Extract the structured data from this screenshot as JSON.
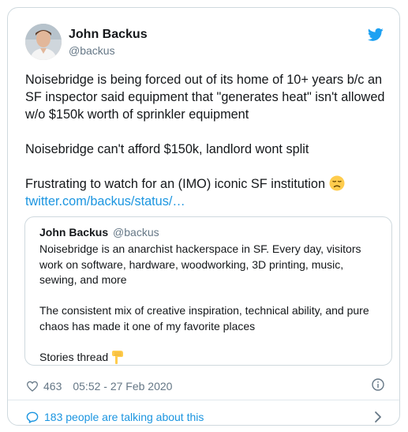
{
  "author": {
    "name": "John Backus",
    "handle": "@backus"
  },
  "tweet": {
    "paragraphs": [
      "Noisebridge is being forced out of its home of 10+ years b/c an SF inspector said equipment that \"generates heat\" isn't allowed w/o $150k worth of sprinkler equipment",
      "Noisebridge can't afford $150k, landlord wont split",
      "Frustrating to watch for an (IMO) iconic SF institution"
    ],
    "emoji": "disappointed-face-emoji",
    "link": "twitter.com/backus/status/…"
  },
  "quoted": {
    "name": "John Backus",
    "handle": "@backus",
    "paragraphs": [
      "Noisebridge is an anarchist hackerspace in SF. Every day, visitors work on software, hardware, woodworking, 3D printing, music, sewing, and more",
      "The consistent mix of creative inspiration, technical ability, and pure chaos has made it one of my favorite places",
      "Stories thread"
    ],
    "emoji": "backhand-pointing-down-emoji"
  },
  "meta": {
    "likes": "463",
    "timestamp": "05:52 - 27 Feb 2020"
  },
  "footer": {
    "talking": "183 people are talking about this"
  },
  "colors": {
    "twitter_blue": "#1da1f2",
    "link_blue": "#1b95e0",
    "muted": "#657786",
    "border": "#cfd9de"
  }
}
